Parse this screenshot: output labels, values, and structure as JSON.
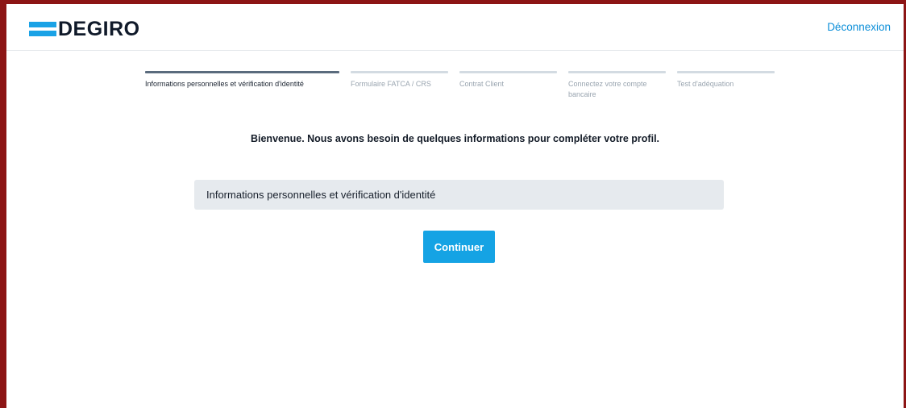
{
  "header": {
    "logo_text": "DEGIRO",
    "logout_label": "Déconnexion",
    "brand_color": "#1aa2e6"
  },
  "steps": [
    {
      "label": "Informations personnelles et vérification d'identité",
      "active": true
    },
    {
      "label": "Formulaire FATCA / CRS",
      "active": false
    },
    {
      "label": "Contrat Client",
      "active": false
    },
    {
      "label": "Connectez votre compte bancaire",
      "active": false
    },
    {
      "label": "Test d'adéquation",
      "active": false
    }
  ],
  "main": {
    "welcome_text": "Bienvenue. Nous avons besoin de quelques informations pour compléter votre profil.",
    "section_label": "Informations personnelles et vérification d'identité",
    "continue_label": "Continuer",
    "button_color": "#15a3e4"
  }
}
